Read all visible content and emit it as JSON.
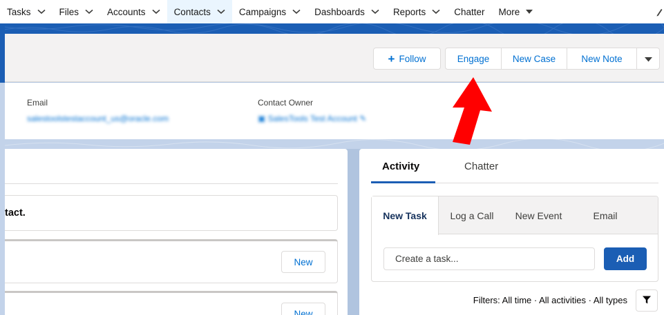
{
  "nav": {
    "items": [
      {
        "label": "Tasks",
        "has_dropdown": true
      },
      {
        "label": "Files",
        "has_dropdown": true
      },
      {
        "label": "Accounts",
        "has_dropdown": true
      },
      {
        "label": "Contacts",
        "has_dropdown": true,
        "active": true
      },
      {
        "label": "Campaigns",
        "has_dropdown": true
      },
      {
        "label": "Dashboards",
        "has_dropdown": true
      },
      {
        "label": "Reports",
        "has_dropdown": true
      },
      {
        "label": "Chatter",
        "has_dropdown": false
      },
      {
        "label": "More",
        "has_dropdown": true
      }
    ],
    "edit_icon": "pencil-icon"
  },
  "header": {
    "follow_label": "Follow",
    "engage_label": "Engage",
    "new_case_label": "New Case",
    "new_note_label": "New Note"
  },
  "highlights": {
    "email_label": "Email",
    "email_value": "salestoolstestaccount_us@oracle.com",
    "owner_label": "Contact Owner",
    "owner_value": "SalesTools Test Account"
  },
  "main": {
    "card_title_partial": "tact.",
    "new_button_1": "New",
    "new_button_2": "New"
  },
  "activity": {
    "tabs": [
      "Activity",
      "Chatter"
    ],
    "active_tab": "Activity",
    "composer_tabs": [
      "New Task",
      "Log a Call",
      "New Event",
      "Email"
    ],
    "active_composer_tab": "New Task",
    "task_placeholder": "Create a task...",
    "add_label": "Add",
    "filters_text": "Filters: All time · All activities · All types"
  },
  "colors": {
    "brand_blue": "#1b5eb4",
    "link_blue": "#0070d2",
    "annotation_arrow": "#ff0000"
  }
}
